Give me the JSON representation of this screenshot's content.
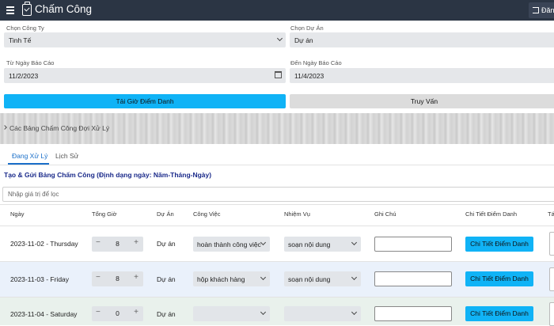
{
  "header": {
    "title": "Chấm Công",
    "logout_label": "Đăn"
  },
  "form": {
    "company_label": "Chọn Công Ty",
    "company_value": "Tinh Tế",
    "project_label": "Chọn Dự Án",
    "project_value": "Dự án",
    "from_label": "Từ Ngày Báo Cáo",
    "from_value": "11/2/2023",
    "to_label": "Đến Ngày Báo Cáo",
    "to_value": "11/4/2023",
    "reload_button": "Tải Giờ Điểm Danh",
    "query_button": "Truy Vấn"
  },
  "pending": {
    "label": "Các Bảng Chấm Công Đợi Xử Lý"
  },
  "tabs": [
    {
      "label": "Đang Xử Lý"
    },
    {
      "label": "Lịch Sử"
    }
  ],
  "section_title": "Tạo & Gửi Bảng Chấm Công (Định dạng ngày: Năm-Tháng-Ngày)",
  "filter": {
    "placeholder": "Nhập giá trị để lọc"
  },
  "table": {
    "headers": [
      "Ngày",
      "Tổng Giờ",
      "Dự Án",
      "Công Việc",
      "Nhiệm Vụ",
      "Ghi Chú",
      "Chi Tiết Điểm Danh",
      "Tá"
    ],
    "rows": [
      {
        "date": "2023-11-02 - Thursday",
        "hours": "8",
        "project": "Dự án",
        "job": "hoàn thành công việc",
        "task": "soạn nội dung",
        "detail": "Chi Tiết Điểm Danh"
      },
      {
        "date": "2023-11-03 - Friday",
        "hours": "8",
        "project": "Dự án",
        "job": "hộp khách hàng",
        "task": "soạn nội dung",
        "detail": "Chi Tiết Điểm Danh"
      },
      {
        "date": "2023-11-04 - Saturday",
        "hours": "0",
        "project": "Dự án",
        "job": "",
        "task": "",
        "detail": "Chi Tiết Điểm Danh"
      }
    ],
    "row_colors": [
      "#ffffff",
      "#eaf1fb",
      "#e9f1ec"
    ]
  },
  "colors": {
    "topbar": "#2b3544",
    "accent": "#10b3f6",
    "title": "#1a2a8a",
    "tab_active": "#1a6fc9"
  }
}
